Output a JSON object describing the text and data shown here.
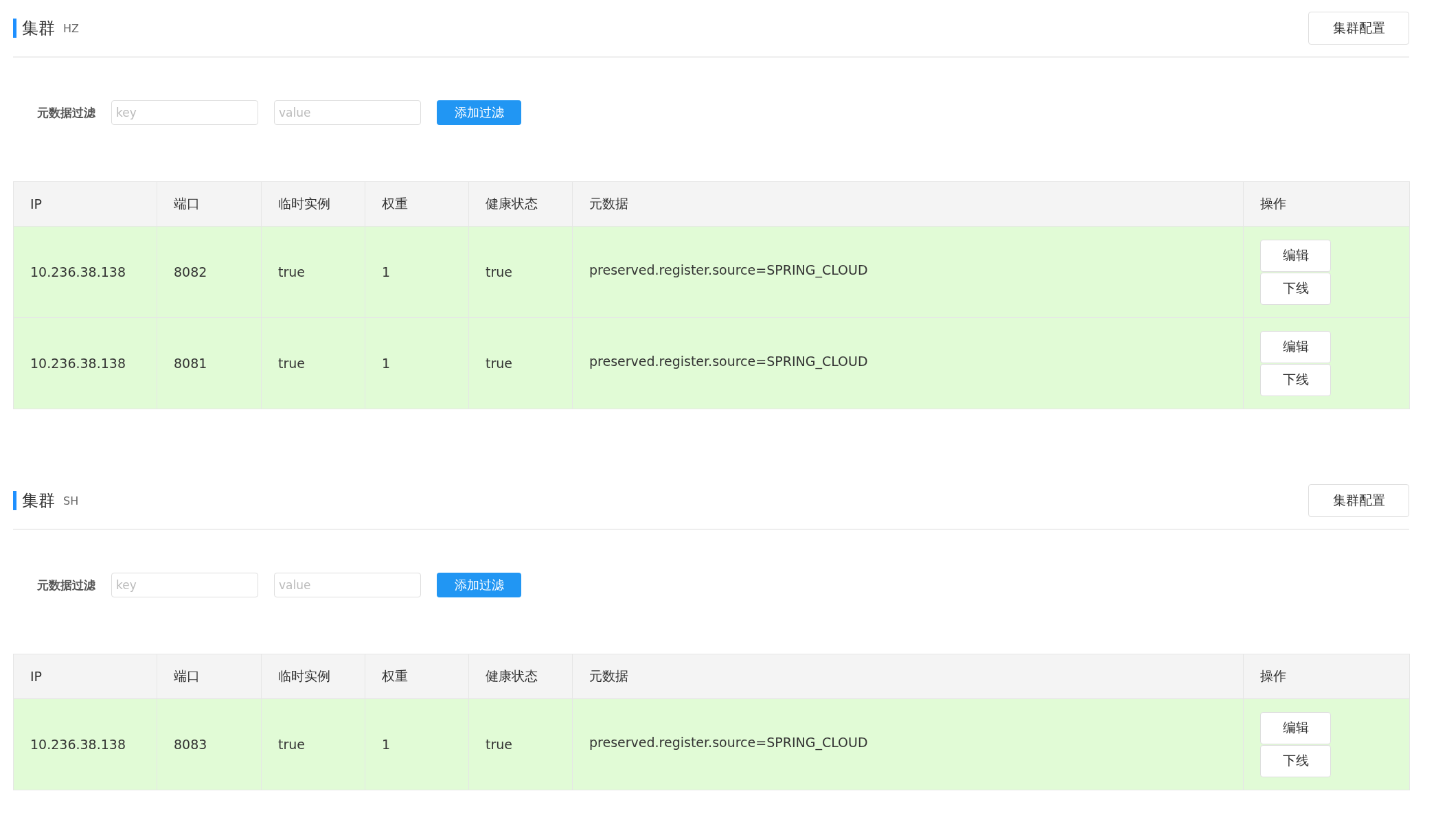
{
  "clusters": [
    {
      "title": "集群",
      "name": "HZ",
      "config_button": "集群配置",
      "filter": {
        "label": "元数据过滤",
        "key_placeholder": "key",
        "value_placeholder": "value",
        "button": "添加过滤"
      },
      "columns": [
        "IP",
        "端口",
        "临时实例",
        "权重",
        "健康状态",
        "元数据",
        "操作"
      ],
      "rows": [
        {
          "ip": "10.236.38.138",
          "port": "8082",
          "ephemeral": "true",
          "weight": "1",
          "healthy": "true",
          "metadata": "preserved.register.source=SPRING_CLOUD",
          "actions": [
            "编辑",
            "下线"
          ]
        },
        {
          "ip": "10.236.38.138",
          "port": "8081",
          "ephemeral": "true",
          "weight": "1",
          "healthy": "true",
          "metadata": "preserved.register.source=SPRING_CLOUD",
          "actions": [
            "编辑",
            "下线"
          ]
        }
      ]
    },
    {
      "title": "集群",
      "name": "SH",
      "config_button": "集群配置",
      "filter": {
        "label": "元数据过滤",
        "key_placeholder": "key",
        "value_placeholder": "value",
        "button": "添加过滤"
      },
      "columns": [
        "IP",
        "端口",
        "临时实例",
        "权重",
        "健康状态",
        "元数据",
        "操作"
      ],
      "rows": [
        {
          "ip": "10.236.38.138",
          "port": "8083",
          "ephemeral": "true",
          "weight": "1",
          "healthy": "true",
          "metadata": "preserved.register.source=SPRING_CLOUD",
          "actions": [
            "编辑",
            "下线"
          ]
        }
      ]
    }
  ]
}
